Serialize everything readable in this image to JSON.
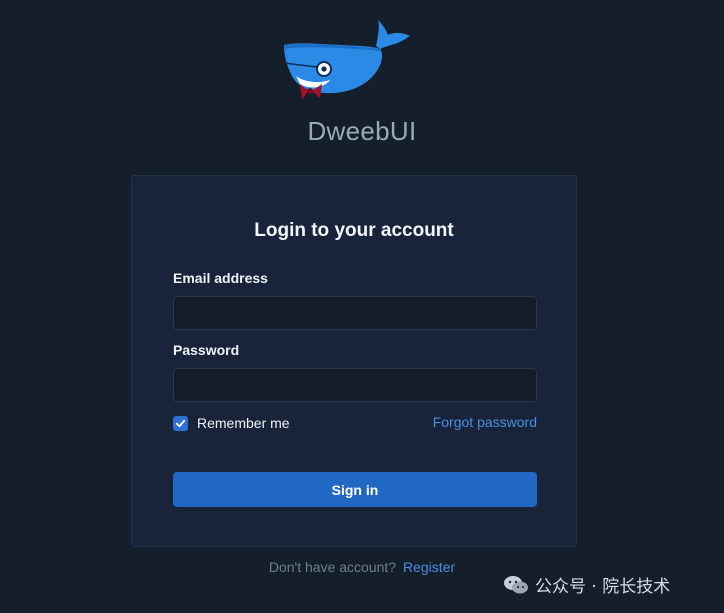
{
  "app": {
    "name": "DweebUI",
    "logo_icon": "whale-icon"
  },
  "login": {
    "title": "Login to your account",
    "email": {
      "label": "Email address",
      "value": "",
      "placeholder": ""
    },
    "password": {
      "label": "Password",
      "value": "",
      "placeholder": ""
    },
    "remember": {
      "label": "Remember me",
      "checked": true
    },
    "forgot_label": "Forgot password",
    "submit_label": "Sign in"
  },
  "footer": {
    "text": "Don't have account?",
    "register_label": "Register"
  },
  "watermark": {
    "text": "公众号 · 院长技术",
    "icon": "wechat-icon"
  },
  "colors": {
    "background": "#151f2c",
    "card": "#19243a",
    "accent": "#2168c5",
    "link": "#4a8fe0",
    "whale": "#2b8ae6"
  }
}
